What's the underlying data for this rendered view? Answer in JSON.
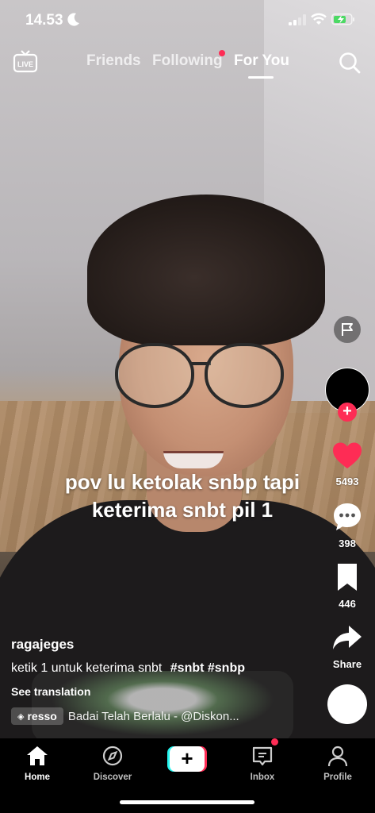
{
  "status_bar": {
    "time": "14.53"
  },
  "top_nav": {
    "tabs": [
      {
        "label": "Friends"
      },
      {
        "label": "Following"
      },
      {
        "label": "For You"
      }
    ]
  },
  "video": {
    "overlay_text_line1": "pov lu ketolak snbp tapi",
    "overlay_text_line2": "keterima snbt pil 1"
  },
  "rail": {
    "likes": "5493",
    "comments": "398",
    "saves": "446",
    "share_label": "Share"
  },
  "post": {
    "username": "ragajeges",
    "caption": "ketik 1 untuk keterima snbt",
    "hashtags": "#snbt #snbp",
    "see_translation": "See translation",
    "music_badge": "resso",
    "music_title": "Badai Telah Berlalu - @Diskon..."
  },
  "bottom_nav": {
    "items": [
      {
        "label": "Home"
      },
      {
        "label": "Discover"
      },
      {
        "label": "Inbox"
      },
      {
        "label": "Profile"
      }
    ]
  },
  "colors": {
    "accent": "#fe2c55",
    "cyan": "#25f4ee"
  }
}
